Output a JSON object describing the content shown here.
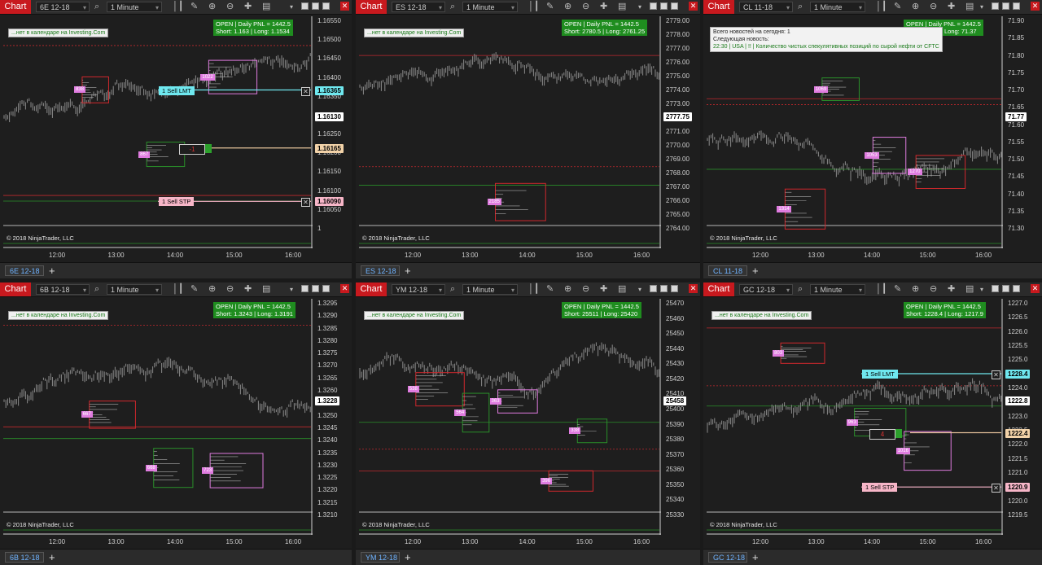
{
  "toolbar": {
    "chart_label": "Chart",
    "interval": "1 Minute"
  },
  "copyright": "© 2018 NinjaTrader, LLC",
  "calendar_text": "...нет в календаре на Investing.Com",
  "panels": [
    {
      "id": "6e",
      "instrument": "6E 12-18",
      "tab": "6E 12-18",
      "pnl": [
        "OPEN | Daily PNL = 1442.5",
        "Short: 1.163 | Long: 1.1534"
      ],
      "prices": [
        "1.16550",
        "1.16500",
        "1.16450",
        "1.16400",
        "1.16350",
        "1.16300",
        "1.16250",
        "1.16200",
        "1.16150",
        "1.16100",
        "1.16050",
        "1"
      ],
      "times": [
        "12:00",
        "13:00",
        "14:00",
        "15:00",
        "16:00"
      ],
      "current_price": "1.16130",
      "orders": [
        {
          "label": "1  Sell LMT",
          "price": "1.16365",
          "color": "#6fe8ef"
        },
        {
          "label": "1  Sell STP",
          "price": "1.16090",
          "color": "#f7b6c8"
        }
      ],
      "position": {
        "qty": "-1",
        "price": "1.16165"
      },
      "vp_labels": [
        "838",
        "867",
        "1022"
      ]
    },
    {
      "id": "es",
      "instrument": "ES 12-18",
      "tab": "ES 12-18",
      "pnl": [
        "OPEN | Daily PNL = 1442.5",
        "Short: 2780.5 | Long: 2761.25"
      ],
      "prices": [
        "2779.00",
        "2778.00",
        "2777.00",
        "2776.00",
        "2775.00",
        "2774.00",
        "2773.00",
        "2772.00",
        "2771.00",
        "2770.00",
        "2769.00",
        "2768.00",
        "2767.00",
        "2766.00",
        "2765.00",
        "2764.00"
      ],
      "times": [
        "12:00",
        "13:00",
        "14:00",
        "15:00",
        "16:00"
      ],
      "current_price": "2777.75",
      "vp_labels": [
        "2185"
      ]
    },
    {
      "id": "cl",
      "instrument": "CL 11-18",
      "tab": "CL 11-18",
      "pnl": [
        "OPEN | Daily PNL = 1442.5",
        "Short: 76.17 | Long: 71.37"
      ],
      "prices": [
        "71.90",
        "71.85",
        "71.80",
        "71.75",
        "71.70",
        "71.65",
        "71.60",
        "71.55",
        "71.50",
        "71.45",
        "71.40",
        "71.35",
        "71.30"
      ],
      "times": [
        "12:00",
        "13:00",
        "14:00",
        "15:00",
        "16:00"
      ],
      "current_price": "71.77",
      "news": [
        "Всего новостей на сегодня: 1",
        "Следующая новость:",
        "22:30  |  USA  |  !!  |  Количество чистых спекулятивных позиций по сырой нефти от CFTC"
      ],
      "vp_labels": [
        "1314",
        "1069",
        "1053",
        "1270"
      ]
    },
    {
      "id": "6b",
      "instrument": "6B 12-18",
      "tab": "6B 12-18",
      "pnl": [
        "OPEN | Daily PNL = 1442.5",
        "Short: 1.3243 | Long: 1.3191"
      ],
      "prices": [
        "1.3295",
        "1.3290",
        "1.3285",
        "1.3280",
        "1.3275",
        "1.3270",
        "1.3265",
        "1.3260",
        "1.3255",
        "1.3250",
        "1.3245",
        "1.3240",
        "1.3235",
        "1.3230",
        "1.3225",
        "1.3220",
        "1.3215",
        "1.3210"
      ],
      "times": [
        "12:00",
        "13:00",
        "14:00",
        "15:00",
        "16:00"
      ],
      "current_price": "1.3228",
      "vp_labels": [
        "667",
        "668",
        "723"
      ]
    },
    {
      "id": "ym",
      "instrument": "YM 12-18",
      "tab": "YM 12-18",
      "pnl": [
        "OPEN | Daily PNL = 1442.5",
        "Short: 25511 | Long: 25420"
      ],
      "prices": [
        "25470",
        "25460",
        "25450",
        "25440",
        "25430",
        "25420",
        "25410",
        "25400",
        "25390",
        "25380",
        "25370",
        "25360",
        "25350",
        "25340",
        "25330"
      ],
      "times": [
        "12:00",
        "13:00",
        "14:00",
        "15:00",
        "16:00"
      ],
      "current_price": "25458",
      "vp_labels": [
        "538",
        "564",
        "363",
        "396",
        "338"
      ]
    },
    {
      "id": "gc",
      "instrument": "GC 12-18",
      "tab": "GC 12-18",
      "pnl": [
        "OPEN | Daily PNL = 1442.5",
        "Short: 1228.4 | Long: 1217.9"
      ],
      "prices": [
        "1227.0",
        "1226.5",
        "1226.0",
        "1225.5",
        "1225.0",
        "1224.5",
        "1224.0",
        "1223.5",
        "1223.0",
        "1222.5",
        "1222.0",
        "1221.5",
        "1221.0",
        "1220.5",
        "1220.0",
        "1219.5"
      ],
      "times": [
        "12:00",
        "13:00",
        "14:00",
        "15:00",
        "16:00"
      ],
      "current_price": "1222.8",
      "orders": [
        {
          "label": "1  Sell LMT",
          "price": "1228.4",
          "color": "#6fe8ef"
        },
        {
          "label": "1  Sell STP",
          "price": "1220.9",
          "color": "#f7b6c8"
        }
      ],
      "position": {
        "qty": "4",
        "price": "1222.4"
      },
      "vp_labels": [
        "803",
        "963",
        "1016"
      ]
    }
  ],
  "colors": {
    "chart_red": "#c8191e",
    "pnl_green": "#1f8d1f",
    "candle": "#8a8a8a",
    "red_line": "#c0282d",
    "green_line": "#2a8f2a",
    "sell_lmt": "#6fe8ef",
    "sell_stp": "#f7b6c8"
  }
}
